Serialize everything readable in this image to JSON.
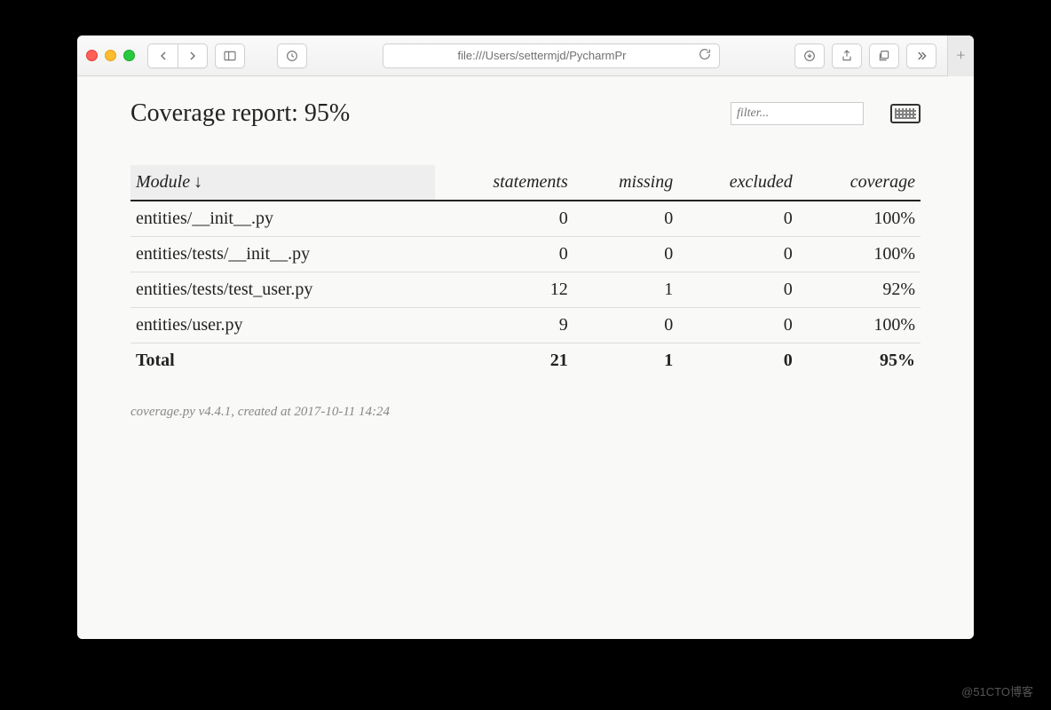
{
  "browser": {
    "address": "file:///Users/settermjd/PycharmPr"
  },
  "header": {
    "title": "Coverage report: 95%",
    "filter_placeholder": "filter..."
  },
  "table": {
    "columns": [
      "Module",
      "statements",
      "missing",
      "excluded",
      "coverage"
    ],
    "sort_indicator": "↓",
    "rows": [
      {
        "module": "entities/__init__.py",
        "statements": "0",
        "missing": "0",
        "excluded": "0",
        "coverage": "100%"
      },
      {
        "module": "entities/tests/__init__.py",
        "statements": "0",
        "missing": "0",
        "excluded": "0",
        "coverage": "100%"
      },
      {
        "module": "entities/tests/test_user.py",
        "statements": "12",
        "missing": "1",
        "excluded": "0",
        "coverage": "92%"
      },
      {
        "module": "entities/user.py",
        "statements": "9",
        "missing": "0",
        "excluded": "0",
        "coverage": "100%"
      }
    ],
    "total": {
      "module": "Total",
      "statements": "21",
      "missing": "1",
      "excluded": "0",
      "coverage": "95%"
    }
  },
  "footer": {
    "text": "coverage.py v4.4.1, created at 2017-10-11 14:24"
  },
  "watermark": "@51CTO博客"
}
